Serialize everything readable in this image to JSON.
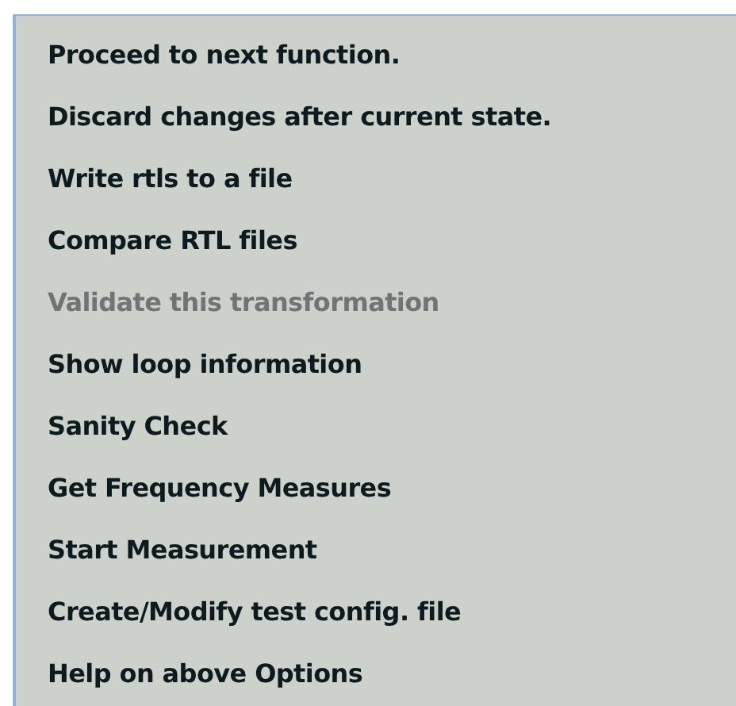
{
  "menu": {
    "items": [
      {
        "label": "Proceed to next function.",
        "disabled": false
      },
      {
        "label": "Discard changes after current state.",
        "disabled": false
      },
      {
        "label": "Write rtls to a file",
        "disabled": false
      },
      {
        "label": "Compare RTL files",
        "disabled": false
      },
      {
        "label": "Validate this transformation",
        "disabled": true
      },
      {
        "label": "Show loop information",
        "disabled": false
      },
      {
        "label": "Sanity Check",
        "disabled": false
      },
      {
        "label": "Get Frequency Measures",
        "disabled": false
      },
      {
        "label": "Start Measurement",
        "disabled": false
      },
      {
        "label": "Create/Modify test config. file",
        "disabled": false
      },
      {
        "label": "Help on above Options",
        "disabled": false
      }
    ]
  }
}
